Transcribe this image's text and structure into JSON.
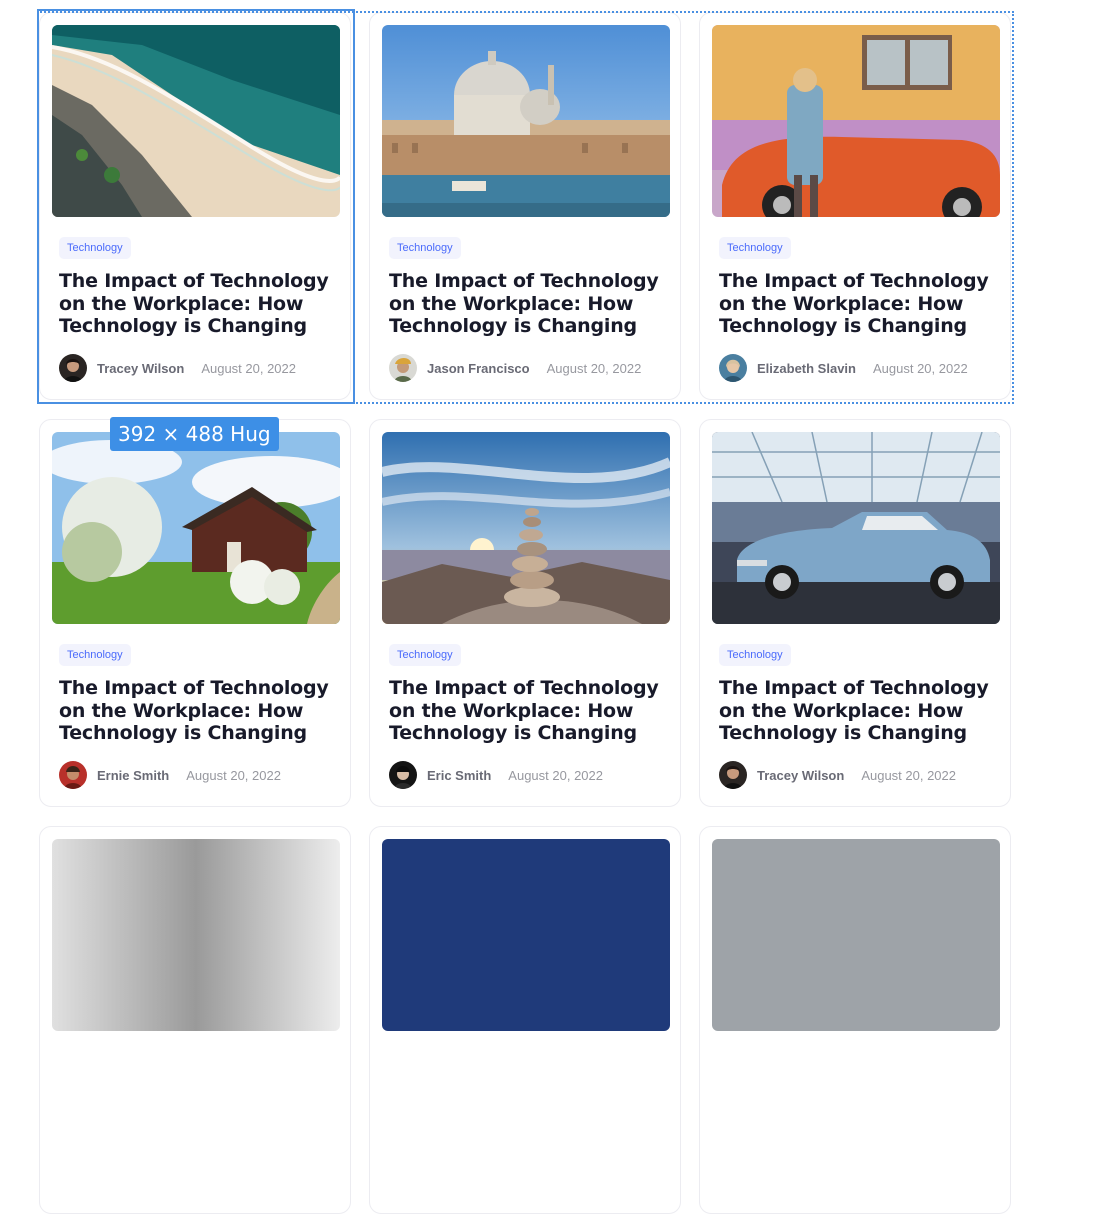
{
  "selection": {
    "size_label": "392 × 488 Hug"
  },
  "cards": [
    {
      "tag": "Technology",
      "title": "The Impact of Technology on the Workplace: How Technology is Changing",
      "author": "Tracey Wilson",
      "date": "August 20, 2022",
      "image": "beach-aerial-image"
    },
    {
      "tag": "Technology",
      "title": "The Impact of Technology on the Workplace: How Technology is Changing",
      "author": "Jason Francisco",
      "date": "August 20, 2022",
      "image": "venice-canal-image"
    },
    {
      "tag": "Technology",
      "title": "The Impact of Technology on the Workplace: How Technology is Changing",
      "author": "Elizabeth Slavin",
      "date": "August 20, 2022",
      "image": "woman-orange-car-image"
    },
    {
      "tag": "Technology",
      "title": "The Impact of Technology on the Workplace: How Technology is Changing",
      "author": "Ernie Smith",
      "date": "August 20, 2022",
      "image": "cottage-field-image"
    },
    {
      "tag": "Technology",
      "title": "The Impact of Technology on the Workplace: How Technology is Changing",
      "author": "Eric Smith",
      "date": "August 20, 2022",
      "image": "stone-cairn-sunset-image"
    },
    {
      "tag": "Technology",
      "title": "The Impact of Technology on the Workplace: How Technology is Changing",
      "author": "Tracey Wilson",
      "date": "August 20, 2022",
      "image": "vintage-blue-car-image"
    }
  ],
  "colors": {
    "accent": "#4b6bfb",
    "tag_bg": "#f2f3fd",
    "title": "#181a2a",
    "meta": "#97989f",
    "selection": "#4a90e2"
  }
}
